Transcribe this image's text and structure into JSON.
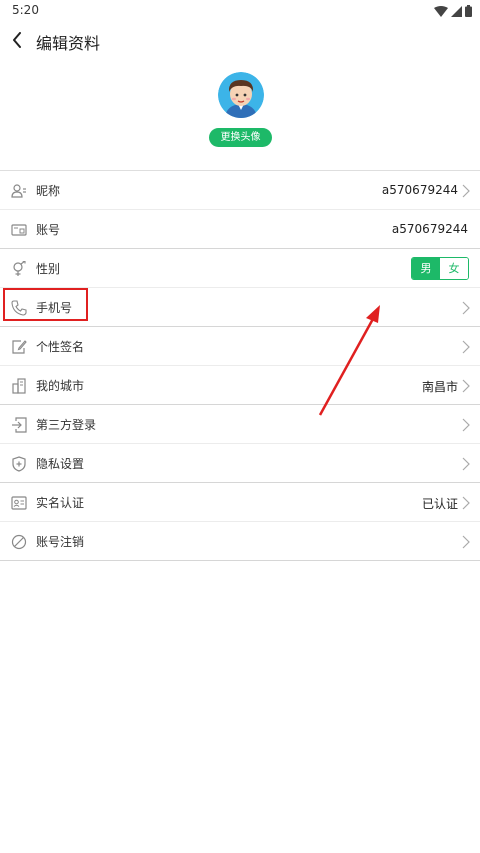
{
  "status_bar": {
    "time": "5:20"
  },
  "header": {
    "title": "编辑资料"
  },
  "profile": {
    "change_avatar_label": "更换头像"
  },
  "rows": [
    {
      "label": "昵称",
      "value": "a570679244",
      "icon": "user-icon"
    },
    {
      "label": "账号",
      "value": "a570679244",
      "icon": "id-card-icon"
    },
    {
      "label": "性别",
      "icon": "gender-icon",
      "options": [
        "男",
        "女"
      ],
      "selected": "男"
    },
    {
      "label": "手机号",
      "icon": "phone-icon"
    },
    {
      "label": "个性签名",
      "icon": "signature-icon"
    },
    {
      "label": "我的城市",
      "value": "南昌市",
      "icon": "building-icon"
    },
    {
      "label": "第三方登录",
      "icon": "login-icon"
    },
    {
      "label": "隐私设置",
      "icon": "shield-icon"
    },
    {
      "label": "实名认证",
      "value": "已认证",
      "icon": "id-verify-icon"
    },
    {
      "label": "账号注销",
      "icon": "cancel-icon"
    }
  ],
  "colors": {
    "accent": "#1db968",
    "annotation": "#e02020"
  }
}
